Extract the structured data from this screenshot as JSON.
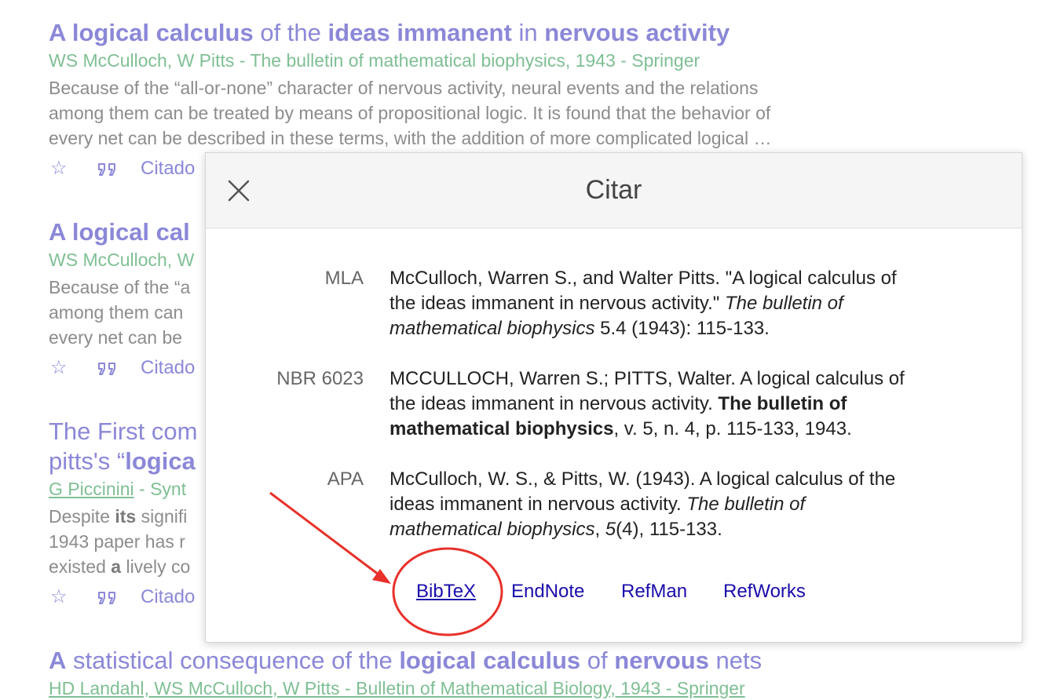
{
  "results": [
    {
      "title": [
        "A logical calculus",
        " of the ",
        "ideas immanent",
        " in ",
        "nervous activity"
      ],
      "meta": "WS McCulloch, W Pitts - The bulletin of mathematical biophysics, 1943 - Springer",
      "snippet": [
        "Because of the “all-or-none” character of nervous activity, neural events and the relations",
        "among them can be treated by means of propositional logic. It is found that the behavior of",
        "every net can be described in these terms, with the addition of more complicated logical …"
      ],
      "cited": "Citado"
    },
    {
      "title": [
        "A logical cal"
      ],
      "meta": "WS McCulloch, W",
      "snippet": [
        "Because of the “a",
        "among them can",
        "every net can be"
      ],
      "cited": "Citado"
    },
    {
      "title_line1": "The First com",
      "title_line2": [
        "pitts's “",
        "logica"
      ],
      "meta_author": "G Piccinini",
      "meta_rest": " - Synt",
      "snippet": [
        [
          "Despite ",
          "its",
          " signifi"
        ],
        [
          "1943 paper has r"
        ],
        [
          "existed ",
          "a",
          " lively co"
        ]
      ],
      "cited": "Citado"
    },
    {
      "title": [
        "A",
        " statistical consequence of the ",
        "logical calculus",
        " of ",
        "nervous",
        " nets"
      ],
      "meta": "HD Landahl, WS McCulloch, W Pitts - Bulletin of Mathematical Biology, 1943 - Springer"
    }
  ],
  "icons": {
    "star": "star-icon",
    "quote": "quote-icon",
    "close": "close-icon"
  },
  "modal": {
    "title": "Citar",
    "citations": [
      {
        "label": "MLA",
        "lines": [
          [
            "McCulloch, Warren S., and Walter Pitts. \"A logical calculus of"
          ],
          [
            "the ideas immanent in nervous activity.\" ",
            "The bulletin of"
          ],
          [
            "mathematical biophysics",
            " 5.4 (1943): 115-133."
          ]
        ]
      },
      {
        "label": "NBR 6023",
        "lines": [
          [
            "MCCULLOCH, Warren S.; PITTS, Walter. A logical calculus of"
          ],
          [
            "the ideas immanent in nervous activity. ",
            "The bulletin of"
          ],
          [
            "mathematical biophysics",
            ", v. 5, n. 4, p. 115-133, 1943."
          ]
        ]
      },
      {
        "label": "APA",
        "lines": [
          [
            "McCulloch, W. S., & Pitts, W. (1943). A logical calculus of the"
          ],
          [
            "ideas immanent in nervous activity. ",
            "The bulletin of"
          ],
          [
            "mathematical biophysics",
            ", ",
            "5",
            "(4), 115-133."
          ]
        ]
      }
    ],
    "exports": [
      "BibTeX",
      "EndNote",
      "RefMan",
      "RefWorks"
    ]
  },
  "colors": {
    "link": "#8b88d8",
    "meta": "#7fbf94",
    "export_link": "#1a0dab",
    "annotation": "#e8312a"
  }
}
